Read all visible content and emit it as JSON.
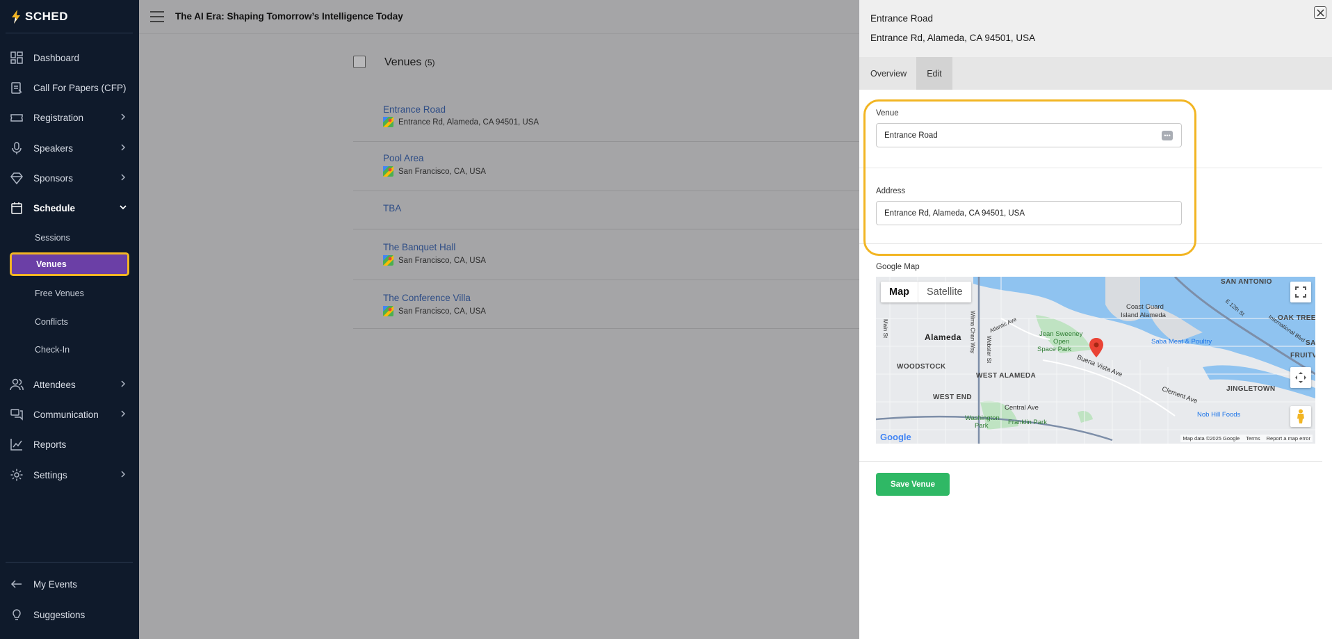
{
  "app": {
    "logo_text": "SCHED",
    "event_title": "The AI Era: Shaping Tomorrow’s Intelligence Today"
  },
  "sidebar": {
    "items": [
      {
        "label": "Dashboard",
        "icon": "dashboard-icon"
      },
      {
        "label": "Call For Papers (CFP)",
        "icon": "clipboard-icon"
      },
      {
        "label": "Registration",
        "icon": "ticket-icon"
      },
      {
        "label": "Speakers",
        "icon": "microphone-icon"
      },
      {
        "label": "Sponsors",
        "icon": "diamond-icon"
      },
      {
        "label": "Schedule",
        "icon": "calendar-icon"
      },
      {
        "label": "Attendees",
        "icon": "users-icon"
      },
      {
        "label": "Communication",
        "icon": "chat-icon"
      },
      {
        "label": "Reports",
        "icon": "chart-line-icon"
      },
      {
        "label": "Settings",
        "icon": "gear-icon"
      }
    ],
    "schedule_sub": [
      "Sessions",
      "Venues",
      "Free Venues",
      "Conflicts",
      "Check-In"
    ],
    "bottom": [
      {
        "label": "My Events",
        "icon": "arrow-left-icon"
      },
      {
        "label": "Suggestions",
        "icon": "lightbulb-icon"
      }
    ]
  },
  "venues": {
    "title": "Venues",
    "count": "(5)",
    "list": [
      {
        "name": "Entrance Road",
        "address": "Entrance Rd, Alameda, CA 94501, USA"
      },
      {
        "name": "Pool Area",
        "address": "San Francisco, CA, USA"
      },
      {
        "name": "TBA",
        "address": ""
      },
      {
        "name": "The Banquet Hall",
        "address": "San Francisco, CA, USA"
      },
      {
        "name": "The Conference Villa",
        "address": "San Francisco, CA, USA"
      }
    ]
  },
  "panel": {
    "title": "Entrance Road",
    "subtitle": "Entrance Rd, Alameda, CA 94501, USA",
    "tabs": [
      "Overview",
      "Edit"
    ],
    "active_tab": "Edit",
    "venue_label": "Venue",
    "venue_value": "Entrance Road",
    "address_label": "Address",
    "address_value": "Entrance Rd, Alameda, CA 94501, USA",
    "map_label": "Google Map",
    "save_label": "Save Venue"
  },
  "map": {
    "type_map": "Map",
    "type_satellite": "Satellite",
    "logo": "Google",
    "footer": [
      "Map data ©2025 Google",
      "Terms",
      "Report a map error"
    ],
    "labels": [
      "SAN ANTONIO",
      "Coast Guard",
      "Island Alameda",
      "OAK TREE",
      "Alameda",
      "Jean Sweeney",
      "Open",
      "Space Park",
      "Saba Meat & Poultry",
      "FRUITV",
      "WOODSTOCK",
      "WEST ALAMEDA",
      "Buena Vista Ave",
      "JINGLETOWN",
      "WEST END",
      "Central Ave",
      "Washington",
      "Park",
      "Franklin Park",
      "Clement Ave",
      "Nob Hill Foods",
      "Atlantic Ave",
      "E 12th St",
      "International Blvd",
      "Webster St",
      "Wilma Chan Way",
      "Main St",
      "SA"
    ]
  },
  "colors": {
    "sidebar_bg": "#0f1a2b",
    "active_item": "#6b3fa6",
    "highlight": "#f2b523",
    "save_button": "#2fb865",
    "link": "#2e4d86"
  }
}
